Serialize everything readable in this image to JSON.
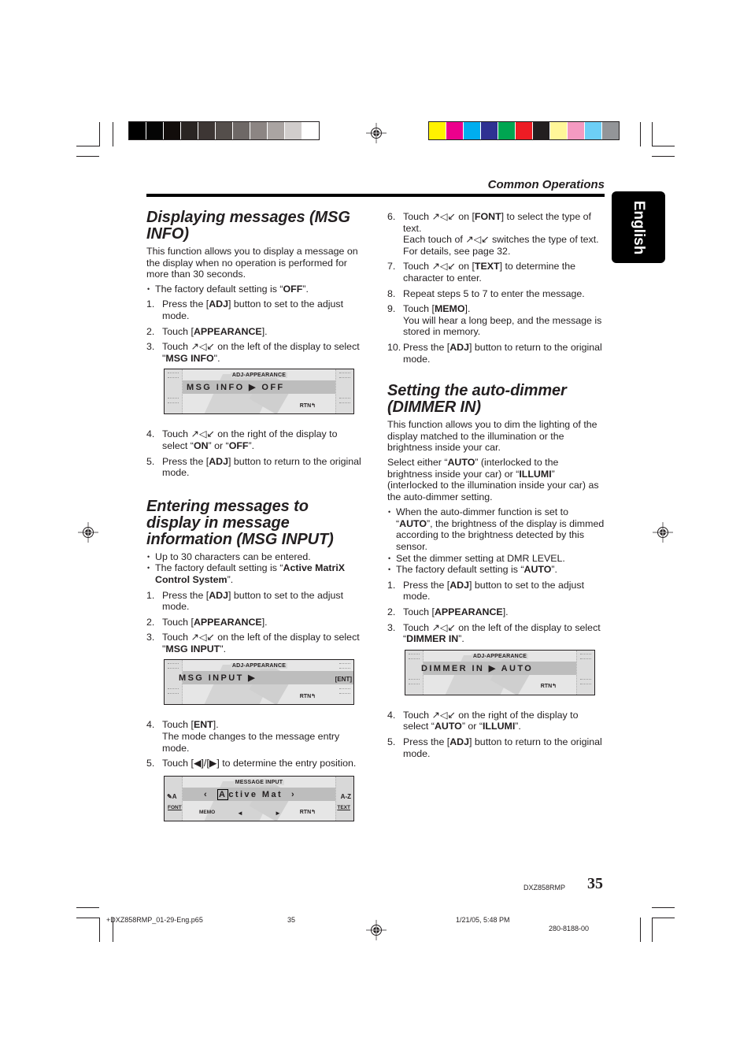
{
  "header": {
    "section_label": "Common Operations",
    "language_tab": "English"
  },
  "colorbars": {
    "grayscale": [
      "#000000",
      "#050505",
      "#120d0b",
      "#2a2523",
      "#3d3634",
      "#544e4b",
      "#6e6866",
      "#8c8583",
      "#aaa4a2",
      "#d1cdcc",
      "#ffffff"
    ],
    "process": [
      "#fff200",
      "#ec008c",
      "#00aeef",
      "#2e3192",
      "#00a651",
      "#ed1c24",
      "#231f20",
      "#fff799",
      "#f49ac1",
      "#6dcff6",
      "#939598"
    ]
  },
  "left": {
    "s1": {
      "title": "Displaying messages (MSG INFO)",
      "intro": "This function allows you to display a message on the display when no operation is performed for more than 30 seconds.",
      "bullet": {
        "pre": "The factory default setting is “",
        "bold": "OFF",
        "post": "”."
      },
      "steps": [
        {
          "num": "1.",
          "pre": "Press the [",
          "bold": "ADJ",
          "post": "] button to set to the adjust mode."
        },
        {
          "num": "2.",
          "pre": "Touch [",
          "bold": "APPEARANCE",
          "post": "]."
        },
        {
          "num": "3.",
          "pre": "Touch ↗◁↙ on the left of the display to select \"",
          "bold": "MSG INFO",
          "post": "\"."
        }
      ],
      "lcd": {
        "title": "ADJ-APPEARANCE",
        "main": "MSG  INFO  ▶  OFF",
        "rtn": "RTN↰"
      },
      "steps2": [
        {
          "num": "4.",
          "pre": "Touch ↗◁↙ on the right of the display to select “",
          "bold": "ON",
          "mid": "” or “",
          "bold2": "OFF",
          "post": "”."
        },
        {
          "num": "5.",
          "pre": "Press the [",
          "bold": "ADJ",
          "post": "] button to return to the original mode."
        }
      ]
    },
    "s2": {
      "title": "Entering messages to display in message information (MSG INPUT)",
      "bullets": [
        {
          "text": "Up to 30 characters can be entered."
        },
        {
          "pre": "The factory default setting is “",
          "bold": "Active MatriX Control System",
          "post": "”."
        }
      ],
      "steps": [
        {
          "num": "1.",
          "pre": "Press the [",
          "bold": "ADJ",
          "post": "] button to set to the adjust mode."
        },
        {
          "num": "2.",
          "pre": "Touch [",
          "bold": "APPEARANCE",
          "post": "]."
        },
        {
          "num": "3.",
          "pre": "Touch ↗◁↙ on the left of the display to select \"",
          "bold": "MSG INPUT",
          "post": "\"."
        }
      ],
      "lcd": {
        "title": "ADJ-APPEARANCE",
        "main": "MSG  INPUT  ▶",
        "ent": "[ENT]",
        "rtn": "RTN↰"
      },
      "steps2": [
        {
          "num": "4.",
          "pre": "Touch [",
          "bold": "ENT",
          "post": "].",
          "sub": "The mode changes to the message entry mode."
        },
        {
          "num": "5.",
          "text": "Touch [◀]/[▶] to determine the entry position."
        }
      ],
      "lcd2": {
        "title": "MESSAGE INPUT",
        "left_label": "✎A",
        "font": "FONT",
        "open": "‹",
        "cursor_char": "A",
        "rest": "ctive  Mat",
        "close": "›",
        "az": "A-Z",
        "text": "TEXT",
        "memo": "MEMO",
        "left_arrow": "◄",
        "right_arrow": "►",
        "rtn": "RTN↰"
      }
    }
  },
  "right": {
    "steps_cont": [
      {
        "num": "6.",
        "pre": "Touch ↗◁↙ on [",
        "bold": "FONT",
        "post": "] to select the type of text.",
        "sub": "Each touch of ↗◁↙ switches the type of text. For details, see page 32."
      },
      {
        "num": "7.",
        "pre": "Touch ↗◁↙ on [",
        "bold": "TEXT",
        "post": "] to determine the character to enter."
      },
      {
        "num": "8.",
        "text": "Repeat steps 5 to 7 to enter the message."
      },
      {
        "num": "9.",
        "pre": "Touch [",
        "bold": "MEMO",
        "post": "].",
        "sub": "You will hear a long beep, and the message is stored in memory."
      },
      {
        "num": "10.",
        "pre": "Press the [",
        "bold": "ADJ",
        "post": "] button to return to the original mode."
      }
    ],
    "s3": {
      "title": "Setting the auto-dimmer (DIMMER IN)",
      "intro": "This function allows you to dim the lighting of the display matched to the illumination or the brightness inside your car.",
      "select": {
        "pre": "Select either “",
        "b1": "AUTO",
        "mid": "” (interlocked to the brightness inside your car) or “",
        "b2": "ILLUMI",
        "post": "” (interlocked to the illumination inside your car) as the auto-dimmer setting."
      },
      "bullets": [
        {
          "pre": "When the auto-dimmer function is set to “",
          "bold": "AUTO",
          "post": "”, the brightness of the display is dimmed according to the brightness detected by this sensor."
        },
        {
          "text": "Set the dimmer setting at DMR LEVEL."
        },
        {
          "pre": "The factory default setting is “",
          "bold": "AUTO",
          "post": "”."
        }
      ],
      "steps": [
        {
          "num": "1.",
          "pre": "Press the [",
          "bold": "ADJ",
          "post": "] button to set to the adjust mode."
        },
        {
          "num": "2.",
          "pre": "Touch [",
          "bold": "APPEARANCE",
          "post": "]."
        },
        {
          "num": "3.",
          "pre": "Touch ↗◁↙ on the left of the display to select “",
          "bold": "DIMMER IN",
          "post": "”."
        }
      ],
      "lcd": {
        "title": "ADJ-APPEARANCE",
        "main": "DIMMER  IN  ▶  AUTO",
        "rtn": "RTN↰"
      },
      "steps2": [
        {
          "num": "4.",
          "pre": "Touch ↗◁↙ on the right of the display to select “",
          "bold": "AUTO",
          "mid": "” or “",
          "bold2": "ILLUMI",
          "post": "”."
        },
        {
          "num": "5.",
          "pre": "Press the [",
          "bold": "ADJ",
          "post": "] button to return to the original mode."
        }
      ]
    }
  },
  "footer": {
    "model": "DXZ858RMP",
    "page_number": "35",
    "file": "+DXZ858RMP_01-29-Eng.p65",
    "file_page": "35",
    "timestamp": "1/21/05, 5:48 PM",
    "part_number": "280-8188-00"
  }
}
